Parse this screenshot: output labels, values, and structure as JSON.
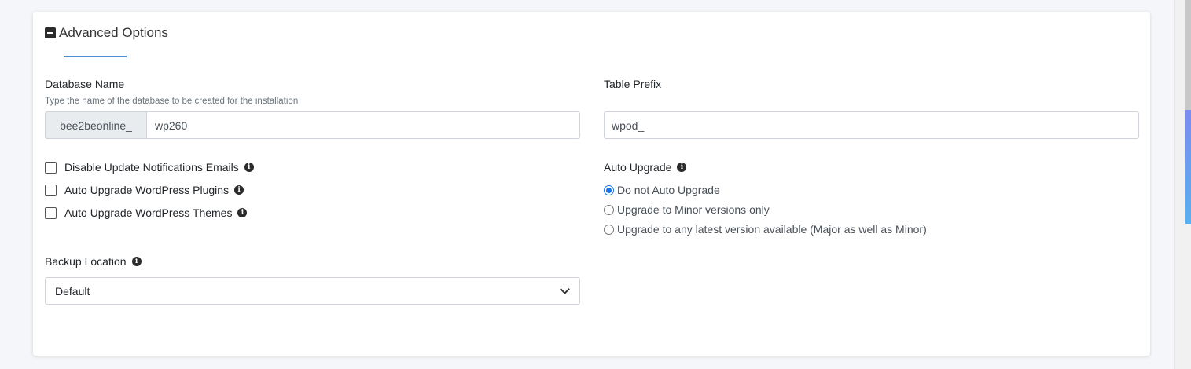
{
  "section": {
    "title": "Advanced Options"
  },
  "database": {
    "label": "Database Name",
    "hint": "Type the name of the database to be created for the installation",
    "prefix": "bee2beonline_",
    "value": "wp260"
  },
  "table_prefix": {
    "label": "Table Prefix",
    "value": "wpod_"
  },
  "checkboxes": [
    {
      "label": "Disable Update Notifications Emails",
      "checked": false
    },
    {
      "label": "Auto Upgrade WordPress Plugins",
      "checked": false
    },
    {
      "label": "Auto Upgrade WordPress Themes",
      "checked": false
    }
  ],
  "auto_upgrade": {
    "label": "Auto Upgrade",
    "options": [
      {
        "label": "Do not Auto Upgrade",
        "checked": true
      },
      {
        "label": "Upgrade to Minor versions only",
        "checked": false
      },
      {
        "label": "Upgrade to any latest version available (Major as well as Minor)",
        "checked": false
      }
    ]
  },
  "backup": {
    "label": "Backup Location",
    "selected": "Default"
  },
  "info_icon_glyph": "i",
  "colors": {
    "accent": "#4a90d9",
    "radio_checked": "#1a73e8"
  }
}
